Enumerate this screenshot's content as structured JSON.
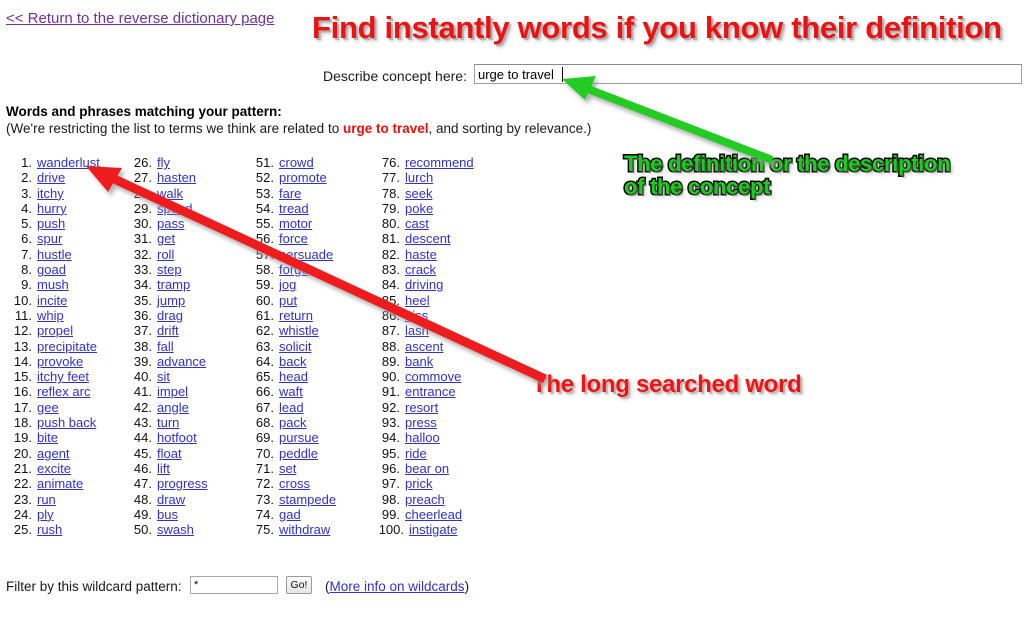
{
  "page": {
    "return_link": "<< Return to the reverse dictionary page",
    "results_heading": "Words and phrases matching your pattern:",
    "subheading_pre": "(We're restricting the list to terms we think are related to ",
    "subheading_keyword": "urge to travel",
    "subheading_post": ", and sorting by relevance.)"
  },
  "search": {
    "label": "Describe concept here:",
    "value": "urge to travel",
    "placeholder": ""
  },
  "annotations": {
    "headline": "Find instantly words if you know their definition",
    "definition": "The definition or the description\nof the concept",
    "searched_word": "The long searched word",
    "headline_color": "#EE1111",
    "definition_color": "#18D018",
    "searched_word_color": "#F51111",
    "red_arrow_color": "#EE1C1C",
    "green_arrow_color": "#22CC22"
  },
  "filter": {
    "label": "Filter by this wildcard pattern:",
    "value": "*",
    "placeholder": "",
    "go_label": "Go!",
    "info_open": "(",
    "info_link": "More info on wildcards",
    "info_close": ")"
  },
  "colors": {
    "link": "#3131CE",
    "visited_link": "#7030A0",
    "keyword_red": "#E8110B"
  },
  "words": [
    {
      "n": 1,
      "w": "wanderlust"
    },
    {
      "n": 2,
      "w": "drive"
    },
    {
      "n": 3,
      "w": "itchy"
    },
    {
      "n": 4,
      "w": "hurry"
    },
    {
      "n": 5,
      "w": "push"
    },
    {
      "n": 6,
      "w": "spur"
    },
    {
      "n": 7,
      "w": "hustle"
    },
    {
      "n": 8,
      "w": "goad"
    },
    {
      "n": 9,
      "w": "mush"
    },
    {
      "n": 10,
      "w": "incite"
    },
    {
      "n": 11,
      "w": "whip"
    },
    {
      "n": 12,
      "w": "propel"
    },
    {
      "n": 13,
      "w": "precipitate"
    },
    {
      "n": 14,
      "w": "provoke"
    },
    {
      "n": 15,
      "w": "itchy feet"
    },
    {
      "n": 16,
      "w": "reflex arc"
    },
    {
      "n": 17,
      "w": "gee"
    },
    {
      "n": 18,
      "w": "push back"
    },
    {
      "n": 19,
      "w": "bite"
    },
    {
      "n": 20,
      "w": "agent"
    },
    {
      "n": 21,
      "w": "excite"
    },
    {
      "n": 22,
      "w": "animate"
    },
    {
      "n": 23,
      "w": "run"
    },
    {
      "n": 24,
      "w": "ply"
    },
    {
      "n": 25,
      "w": "rush"
    },
    {
      "n": 26,
      "w": "fly"
    },
    {
      "n": 27,
      "w": "hasten"
    },
    {
      "n": 28,
      "w": "walk"
    },
    {
      "n": 29,
      "w": "speed"
    },
    {
      "n": 30,
      "w": "pass"
    },
    {
      "n": 31,
      "w": "get"
    },
    {
      "n": 32,
      "w": "roll"
    },
    {
      "n": 33,
      "w": "step"
    },
    {
      "n": 34,
      "w": "tramp"
    },
    {
      "n": 35,
      "w": "jump"
    },
    {
      "n": 36,
      "w": "drag"
    },
    {
      "n": 37,
      "w": "drift"
    },
    {
      "n": 38,
      "w": "fall"
    },
    {
      "n": 39,
      "w": "advance"
    },
    {
      "n": 40,
      "w": "sit"
    },
    {
      "n": 41,
      "w": "impel"
    },
    {
      "n": 42,
      "w": "angle"
    },
    {
      "n": 43,
      "w": "turn"
    },
    {
      "n": 44,
      "w": "hotfoot"
    },
    {
      "n": 45,
      "w": "float"
    },
    {
      "n": 46,
      "w": "lift"
    },
    {
      "n": 47,
      "w": "progress"
    },
    {
      "n": 48,
      "w": "draw"
    },
    {
      "n": 49,
      "w": "bus"
    },
    {
      "n": 50,
      "w": "swash"
    },
    {
      "n": 51,
      "w": "crowd"
    },
    {
      "n": 52,
      "w": "promote"
    },
    {
      "n": 53,
      "w": "fare"
    },
    {
      "n": 54,
      "w": "tread"
    },
    {
      "n": 55,
      "w": "motor"
    },
    {
      "n": 56,
      "w": "force"
    },
    {
      "n": 57,
      "w": "persuade"
    },
    {
      "n": 58,
      "w": "forge"
    },
    {
      "n": 59,
      "w": "jog"
    },
    {
      "n": 60,
      "w": "put"
    },
    {
      "n": 61,
      "w": "return"
    },
    {
      "n": 62,
      "w": "whistle"
    },
    {
      "n": 63,
      "w": "solicit"
    },
    {
      "n": 64,
      "w": "back"
    },
    {
      "n": 65,
      "w": "head"
    },
    {
      "n": 66,
      "w": "waft"
    },
    {
      "n": 67,
      "w": "lead"
    },
    {
      "n": 68,
      "w": "pack"
    },
    {
      "n": 69,
      "w": "pursue"
    },
    {
      "n": 70,
      "w": "peddle"
    },
    {
      "n": 71,
      "w": "set"
    },
    {
      "n": 72,
      "w": "cross"
    },
    {
      "n": 73,
      "w": "stampede"
    },
    {
      "n": 74,
      "w": "gad"
    },
    {
      "n": 75,
      "w": "withdraw"
    },
    {
      "n": 76,
      "w": "recommend"
    },
    {
      "n": 77,
      "w": "lurch"
    },
    {
      "n": 78,
      "w": "seek"
    },
    {
      "n": 79,
      "w": "poke"
    },
    {
      "n": 80,
      "w": "cast"
    },
    {
      "n": 81,
      "w": "descent"
    },
    {
      "n": 82,
      "w": "haste"
    },
    {
      "n": 83,
      "w": "crack"
    },
    {
      "n": 84,
      "w": "driving"
    },
    {
      "n": 85,
      "w": "heel"
    },
    {
      "n": 86,
      "w": "hiss"
    },
    {
      "n": 87,
      "w": "lash"
    },
    {
      "n": 88,
      "w": "ascent"
    },
    {
      "n": 89,
      "w": "bank"
    },
    {
      "n": 90,
      "w": "commove"
    },
    {
      "n": 91,
      "w": "entrance"
    },
    {
      "n": 92,
      "w": "resort"
    },
    {
      "n": 93,
      "w": "press"
    },
    {
      "n": 94,
      "w": "halloo"
    },
    {
      "n": 95,
      "w": "ride"
    },
    {
      "n": 96,
      "w": "bear on"
    },
    {
      "n": 97,
      "w": "prick"
    },
    {
      "n": 98,
      "w": "preach"
    },
    {
      "n": 99,
      "w": "cheerlead"
    },
    {
      "n": 100,
      "w": "instigate"
    }
  ]
}
